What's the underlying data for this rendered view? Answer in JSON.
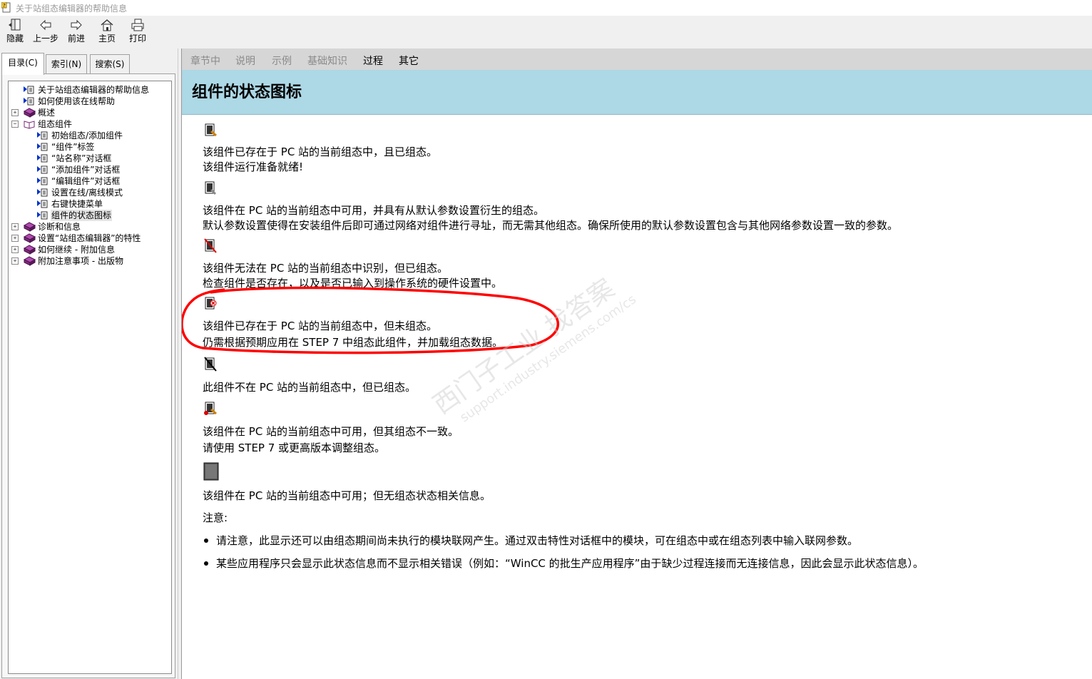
{
  "window": {
    "title": "关于站组态编辑器的帮助信息"
  },
  "toolbar": [
    {
      "label": "隐藏",
      "icon": "hide-icon"
    },
    {
      "label": "上一步",
      "icon": "back-arrow-icon"
    },
    {
      "label": "前进",
      "icon": "forward-arrow-icon"
    },
    {
      "label": "主页",
      "icon": "home-icon"
    },
    {
      "label": "打印",
      "icon": "print-icon"
    }
  ],
  "tabs": [
    "目录(C)",
    "索引(N)",
    "搜索(S)"
  ],
  "tree": [
    {
      "label": "关于站组态编辑器的帮助信息",
      "type": "page"
    },
    {
      "label": "如何使用该在线帮助",
      "type": "page"
    },
    {
      "label": "概述",
      "type": "book",
      "expander": "+"
    },
    {
      "label": "组态组件",
      "type": "open-book",
      "expander": "-"
    },
    {
      "label": "初始组态/添加组件",
      "type": "page"
    },
    {
      "label": "“组件”标签",
      "type": "page"
    },
    {
      "label": "“站名称”对话框",
      "type": "page"
    },
    {
      "label": "“添加组件”对话框",
      "type": "page"
    },
    {
      "label": "“编辑组件”对话框",
      "type": "page"
    },
    {
      "label": "设置在线/离线模式",
      "type": "page"
    },
    {
      "label": "右键快捷菜单",
      "type": "page"
    },
    {
      "label": "组件的状态图标",
      "type": "page",
      "selected": true
    },
    {
      "label": "诊断和信息",
      "type": "book",
      "expander": "+"
    },
    {
      "label": "设置“站组态编辑器”的特性",
      "type": "book",
      "expander": "+"
    },
    {
      "label": "如何继续 - 附加信息",
      "type": "book",
      "expander": "+"
    },
    {
      "label": "附加注意事项 - 出版物",
      "type": "book",
      "expander": "+"
    }
  ],
  "nav_links": [
    {
      "label": "章节中",
      "active": false
    },
    {
      "label": "说明",
      "active": false
    },
    {
      "label": "示例",
      "active": false
    },
    {
      "label": "基础知识",
      "active": false
    },
    {
      "label": "过程",
      "active": true
    },
    {
      "label": "其它",
      "active": true
    }
  ],
  "page_title": "组件的状态图标",
  "entries": [
    {
      "icon": "configured-ready-icon",
      "lines": [
        "该组件已存在于  PC 站的当前组态中，且已组态。",
        "该组件运行准备就绪!"
      ]
    },
    {
      "icon": "default-config-icon",
      "lines": [
        "该组件在  PC 站的当前组态中可用，并具有从默认参数设置衍生的组态。",
        "默认参数设置使得在安装组件后即可通过网络对组件进行寻址，而无需其他组态。确保所使用的默认参数设置包含与其他网络参数设置一致的参数。"
      ]
    },
    {
      "icon": "not-recognized-icon",
      "lines": [
        "该组件无法在  PC 站的当前组态中识别，但已组态。",
        "检查组件是否存在，以及是否已输入到操作系统的硬件设置中。"
      ]
    },
    {
      "icon": "not-configured-icon",
      "lines": [
        "该组件已存在于  PC 站的当前组态中，但未组态。",
        "仍需根据预期应用在  STEP 7 中组态此组件，并加载组态数据。"
      ]
    },
    {
      "icon": "missing-component-icon",
      "lines": [
        "此组件不在  PC 站的当前组态中，但已组态。"
      ]
    },
    {
      "icon": "inconsistent-config-icon",
      "lines": [
        "该组件在  PC 站的当前组态中可用，但其组态不一致。",
        "请使用  STEP 7 或更高版本调整组态。"
      ]
    },
    {
      "icon": "no-status-info-icon",
      "lines": [
        "该组件在  PC 站的当前组态中可用；但无组态状态相关信息。"
      ]
    }
  ],
  "note_label": "注意:",
  "notes": [
    "请注意，此显示还可以由组态期间尚未执行的模块联网产生。通过双击特性对话框中的模块，可在组态中或在组态列表中输入联网参数。",
    "某些应用程序只会显示此状态信息而不显示相关错误（例如：“WinCC 的批生产应用程序”由于缺少过程连接而无连接信息，因此会显示此状态信息）。"
  ],
  "watermark": {
    "line1": "西门子工业  找答案",
    "line2": "support.industry.siemens.com/cs"
  },
  "colors": {
    "banner": "#add8e6",
    "navbar": "#d6d6d6",
    "annotation": "#ff0000",
    "book": "#7b2a7b"
  }
}
